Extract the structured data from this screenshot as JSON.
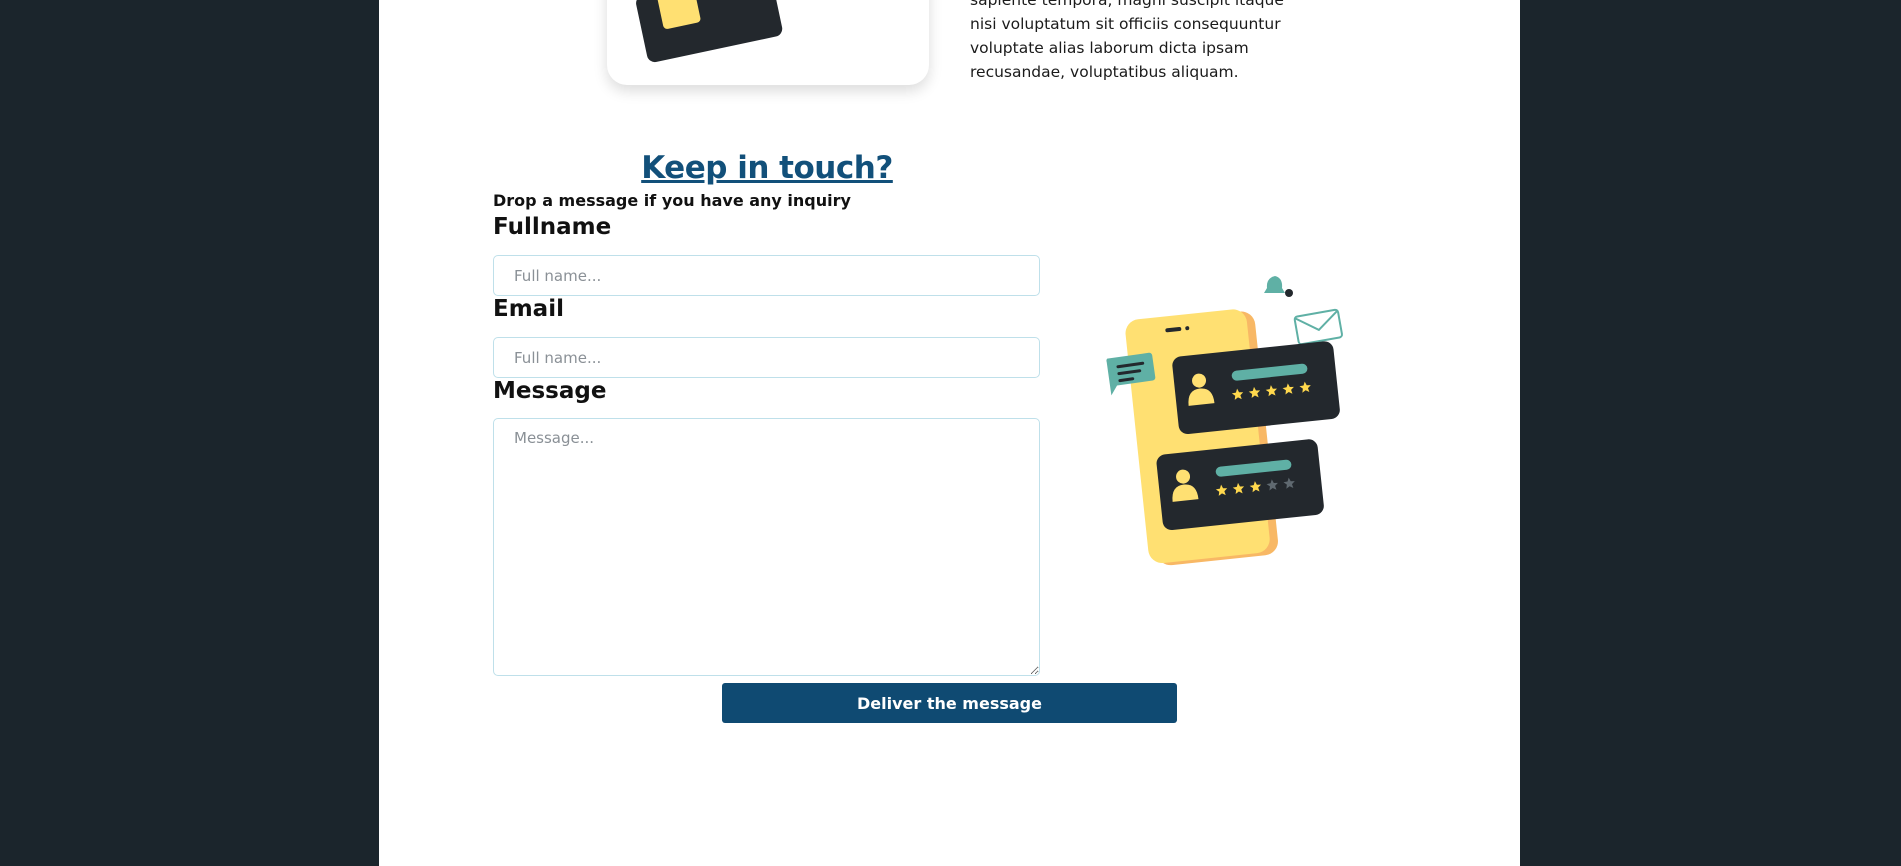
{
  "about": {
    "paragraph": "sapiente tempora, magni suscipit itaque nisi voluptatum sit officiis consequuntur voluptate alias laborum dicta ipsam recusandae, voluptatibus aliquam."
  },
  "contact": {
    "title": "Keep in touch?",
    "subtitle": "Drop a message if you have any inquiry",
    "fullname_label": "Fullname",
    "fullname_placeholder": "Full name...",
    "email_label": "Email",
    "email_placeholder": "Full name...",
    "message_label": "Message",
    "message_placeholder": "Message...",
    "submit_label": "Deliver the message"
  },
  "illustration": {
    "review_cards": [
      {
        "rating": 5,
        "max": 5
      },
      {
        "rating": 3,
        "max": 5
      }
    ],
    "colors": {
      "phone": "#ffe072",
      "card": "#23282d",
      "accent": "#5fb0a5",
      "star_on": "#ffd84d",
      "star_off": "#5f6970"
    }
  }
}
